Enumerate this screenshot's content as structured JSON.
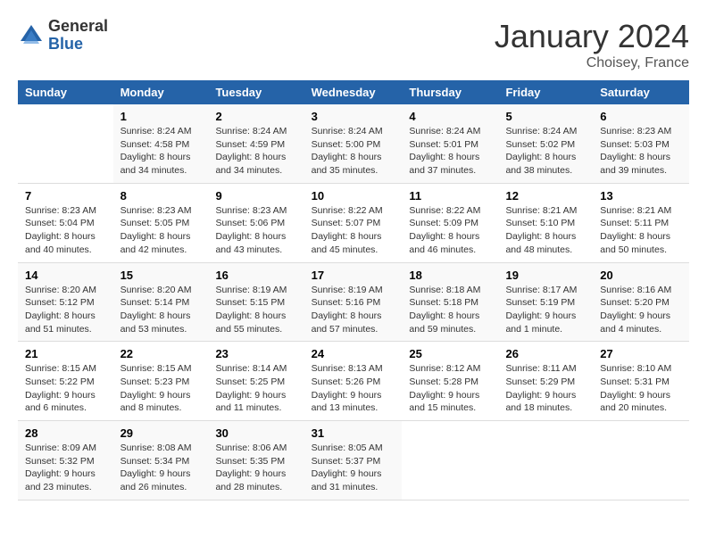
{
  "logo": {
    "general": "General",
    "blue": "Blue"
  },
  "title": "January 2024",
  "location": "Choisey, France",
  "days_header": [
    "Sunday",
    "Monday",
    "Tuesday",
    "Wednesday",
    "Thursday",
    "Friday",
    "Saturday"
  ],
  "weeks": [
    [
      {
        "num": "",
        "info": ""
      },
      {
        "num": "1",
        "info": "Sunrise: 8:24 AM\nSunset: 4:58 PM\nDaylight: 8 hours\nand 34 minutes."
      },
      {
        "num": "2",
        "info": "Sunrise: 8:24 AM\nSunset: 4:59 PM\nDaylight: 8 hours\nand 34 minutes."
      },
      {
        "num": "3",
        "info": "Sunrise: 8:24 AM\nSunset: 5:00 PM\nDaylight: 8 hours\nand 35 minutes."
      },
      {
        "num": "4",
        "info": "Sunrise: 8:24 AM\nSunset: 5:01 PM\nDaylight: 8 hours\nand 37 minutes."
      },
      {
        "num": "5",
        "info": "Sunrise: 8:24 AM\nSunset: 5:02 PM\nDaylight: 8 hours\nand 38 minutes."
      },
      {
        "num": "6",
        "info": "Sunrise: 8:23 AM\nSunset: 5:03 PM\nDaylight: 8 hours\nand 39 minutes."
      }
    ],
    [
      {
        "num": "7",
        "info": "Sunrise: 8:23 AM\nSunset: 5:04 PM\nDaylight: 8 hours\nand 40 minutes."
      },
      {
        "num": "8",
        "info": "Sunrise: 8:23 AM\nSunset: 5:05 PM\nDaylight: 8 hours\nand 42 minutes."
      },
      {
        "num": "9",
        "info": "Sunrise: 8:23 AM\nSunset: 5:06 PM\nDaylight: 8 hours\nand 43 minutes."
      },
      {
        "num": "10",
        "info": "Sunrise: 8:22 AM\nSunset: 5:07 PM\nDaylight: 8 hours\nand 45 minutes."
      },
      {
        "num": "11",
        "info": "Sunrise: 8:22 AM\nSunset: 5:09 PM\nDaylight: 8 hours\nand 46 minutes."
      },
      {
        "num": "12",
        "info": "Sunrise: 8:21 AM\nSunset: 5:10 PM\nDaylight: 8 hours\nand 48 minutes."
      },
      {
        "num": "13",
        "info": "Sunrise: 8:21 AM\nSunset: 5:11 PM\nDaylight: 8 hours\nand 50 minutes."
      }
    ],
    [
      {
        "num": "14",
        "info": "Sunrise: 8:20 AM\nSunset: 5:12 PM\nDaylight: 8 hours\nand 51 minutes."
      },
      {
        "num": "15",
        "info": "Sunrise: 8:20 AM\nSunset: 5:14 PM\nDaylight: 8 hours\nand 53 minutes."
      },
      {
        "num": "16",
        "info": "Sunrise: 8:19 AM\nSunset: 5:15 PM\nDaylight: 8 hours\nand 55 minutes."
      },
      {
        "num": "17",
        "info": "Sunrise: 8:19 AM\nSunset: 5:16 PM\nDaylight: 8 hours\nand 57 minutes."
      },
      {
        "num": "18",
        "info": "Sunrise: 8:18 AM\nSunset: 5:18 PM\nDaylight: 8 hours\nand 59 minutes."
      },
      {
        "num": "19",
        "info": "Sunrise: 8:17 AM\nSunset: 5:19 PM\nDaylight: 9 hours\nand 1 minute."
      },
      {
        "num": "20",
        "info": "Sunrise: 8:16 AM\nSunset: 5:20 PM\nDaylight: 9 hours\nand 4 minutes."
      }
    ],
    [
      {
        "num": "21",
        "info": "Sunrise: 8:15 AM\nSunset: 5:22 PM\nDaylight: 9 hours\nand 6 minutes."
      },
      {
        "num": "22",
        "info": "Sunrise: 8:15 AM\nSunset: 5:23 PM\nDaylight: 9 hours\nand 8 minutes."
      },
      {
        "num": "23",
        "info": "Sunrise: 8:14 AM\nSunset: 5:25 PM\nDaylight: 9 hours\nand 11 minutes."
      },
      {
        "num": "24",
        "info": "Sunrise: 8:13 AM\nSunset: 5:26 PM\nDaylight: 9 hours\nand 13 minutes."
      },
      {
        "num": "25",
        "info": "Sunrise: 8:12 AM\nSunset: 5:28 PM\nDaylight: 9 hours\nand 15 minutes."
      },
      {
        "num": "26",
        "info": "Sunrise: 8:11 AM\nSunset: 5:29 PM\nDaylight: 9 hours\nand 18 minutes."
      },
      {
        "num": "27",
        "info": "Sunrise: 8:10 AM\nSunset: 5:31 PM\nDaylight: 9 hours\nand 20 minutes."
      }
    ],
    [
      {
        "num": "28",
        "info": "Sunrise: 8:09 AM\nSunset: 5:32 PM\nDaylight: 9 hours\nand 23 minutes."
      },
      {
        "num": "29",
        "info": "Sunrise: 8:08 AM\nSunset: 5:34 PM\nDaylight: 9 hours\nand 26 minutes."
      },
      {
        "num": "30",
        "info": "Sunrise: 8:06 AM\nSunset: 5:35 PM\nDaylight: 9 hours\nand 28 minutes."
      },
      {
        "num": "31",
        "info": "Sunrise: 8:05 AM\nSunset: 5:37 PM\nDaylight: 9 hours\nand 31 minutes."
      },
      {
        "num": "",
        "info": ""
      },
      {
        "num": "",
        "info": ""
      },
      {
        "num": "",
        "info": ""
      }
    ]
  ]
}
